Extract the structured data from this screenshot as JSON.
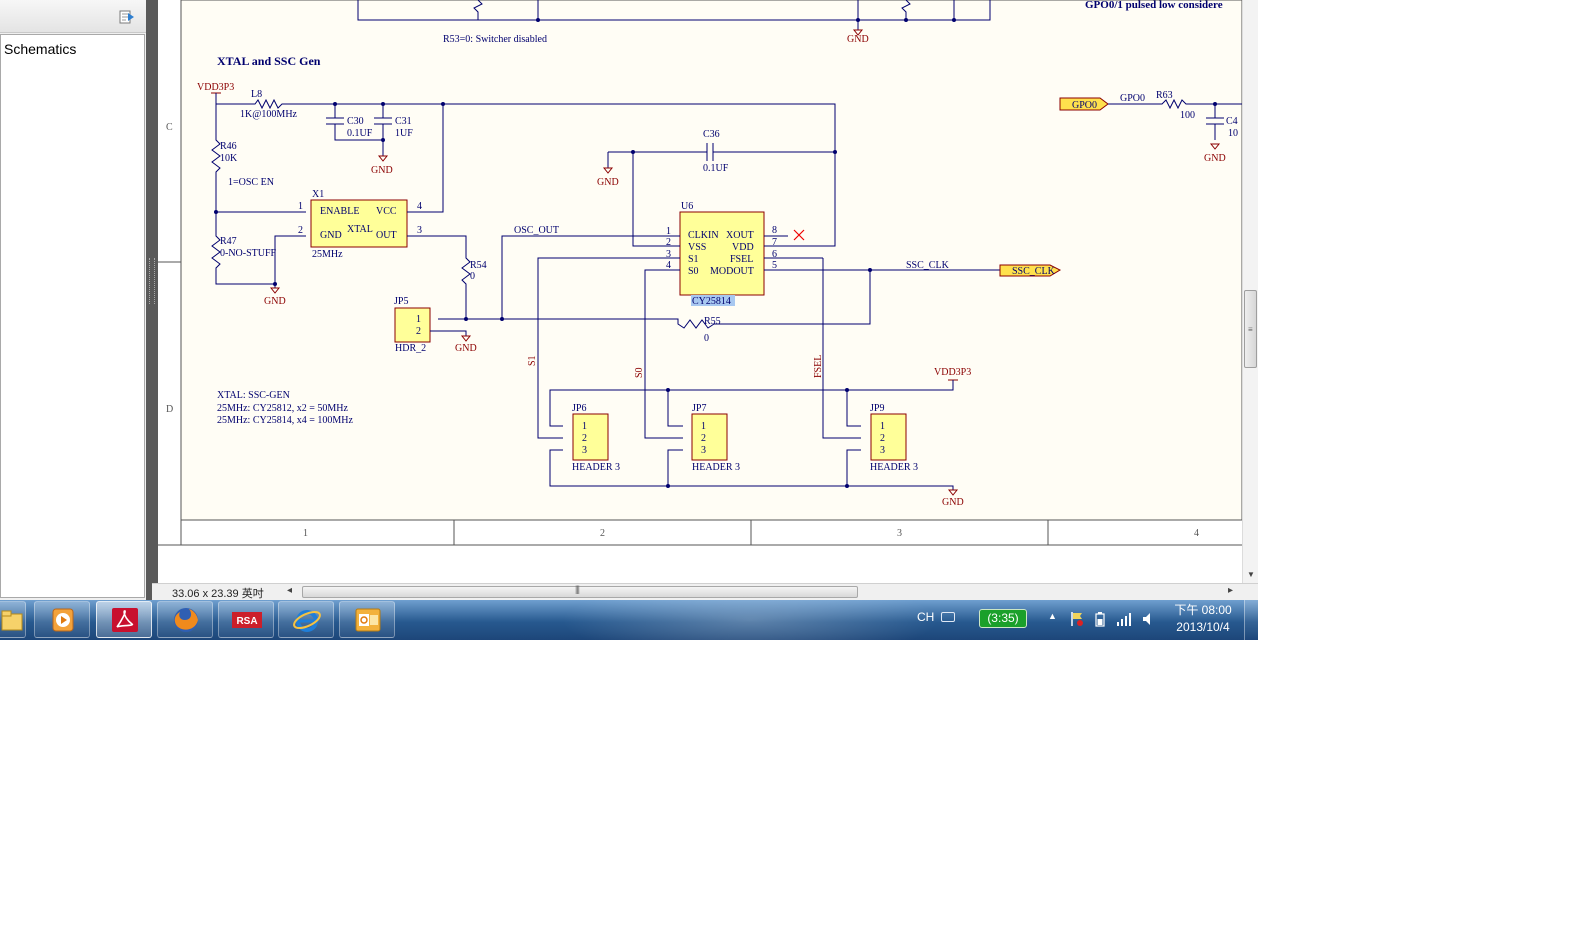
{
  "bookmarks": {
    "item": "Schematics"
  },
  "status": {
    "page_size": "33.06 x 23.39 英吋"
  },
  "schematic": {
    "top_note_r53": "R53=0: Switcher disabled",
    "top_note_gpo": "GPO0/1 pulsed low considere",
    "section_title": "XTAL and SSC Gen",
    "row_c": "C",
    "row_d": "D",
    "col_1": "1",
    "col_2": "2",
    "col_3": "3",
    "col_4": "4",
    "gnd": "GND",
    "vdd": "VDD3P3",
    "l8": "L8",
    "l8_val": "1K@100MHz",
    "c30": "C30",
    "c30_val": "0.1UF",
    "c31": "C31",
    "c31_val": "1UF",
    "r46": "R46",
    "r46_val": "10K",
    "osc_en": "1=OSC EN",
    "r47": "R47",
    "r47_val": "0-NO-STUFF",
    "x1": "X1",
    "x1_enable": "ENABLE",
    "x1_vcc": "VCC",
    "x1_xtal": "XTAL",
    "x1_gnd": "GND",
    "x1_out": "OUT",
    "x1_val": "25MHz",
    "osc_out": "OSC_OUT",
    "r54": "R54",
    "r54_val": "0",
    "jp5": "JP5",
    "jp5_val": "HDR_2",
    "c36": "C36",
    "c36_val": "0.1UF",
    "u6": "U6",
    "u6_clkin": "CLKIN",
    "u6_xout": "XOUT",
    "u6_vss": "VSS",
    "u6_vdd": "VDD",
    "u6_s1": "S1",
    "u6_fsel": "FSEL",
    "u6_s0": "S0",
    "u6_modout": "MODOUT",
    "u6_val": "CY25814",
    "ssc_clk": "SSC_CLK",
    "r55": "R55",
    "r55_val": "0",
    "net_s1": "S1",
    "net_s0": "S0",
    "net_fsel": "FSEL",
    "jp6": "JP6",
    "jp7": "JP7",
    "jp9": "JP9",
    "header3": "HEADER 3",
    "gpo0_flag": "GPO0",
    "gpo0_net": "GPO0",
    "r63": "R63",
    "r63_val": "100",
    "c4x": "C4",
    "c4x_val": "10",
    "note_1": "XTAL:  SSC-GEN",
    "note_2": "25MHz:  CY25812, x2 = 50MHz",
    "note_3": "25MHz:  CY25814, x4 = 100MHz",
    "pin_1": "1",
    "pin_2": "2",
    "pin_3": "3",
    "pin_4": "4",
    "pin_5": "5",
    "pin_6": "6",
    "pin_7": "7",
    "pin_8": "8"
  },
  "tray": {
    "lang": "CH",
    "battery": "(3:35)",
    "time": "下午 08:00",
    "date": "2013/10/4"
  },
  "taskbar_apps": [
    {
      "icon": "explorer-icon"
    },
    {
      "icon": "media-player-icon"
    },
    {
      "icon": "adobe-reader-icon"
    },
    {
      "icon": "firefox-icon"
    },
    {
      "icon": "rsa-icon"
    },
    {
      "icon": "internet-explorer-icon"
    },
    {
      "icon": "outlook-icon"
    }
  ]
}
